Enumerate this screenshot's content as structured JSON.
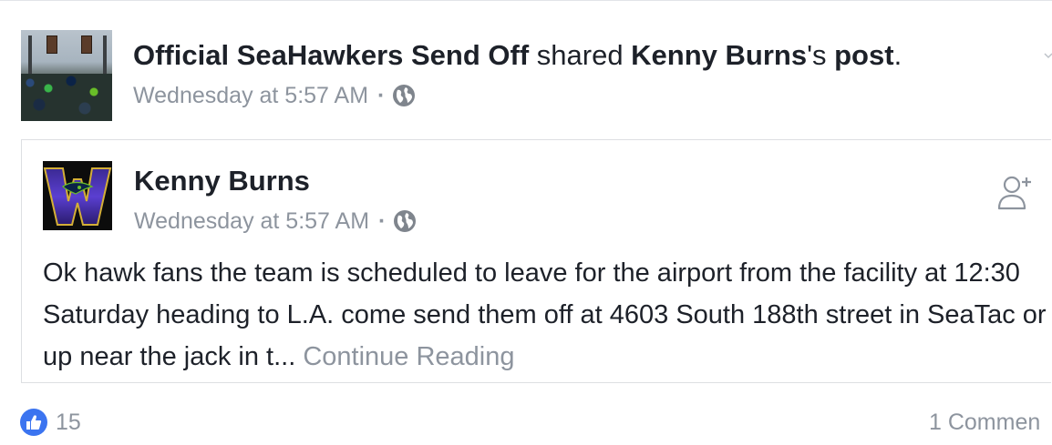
{
  "shared_post": {
    "page_name": "Official SeaHawkers Send Off",
    "action_text": " shared ",
    "original_author": "Kenny Burns",
    "possessive": "'s ",
    "object": "post",
    "period": ".",
    "timestamp": "Wednesday at 5:57 AM",
    "separator": "·",
    "audience_icon": "globe-icon"
  },
  "original_post": {
    "author": "Kenny Burns",
    "timestamp": "Wednesday at 5:57 AM",
    "separator": "·",
    "audience_icon": "globe-icon",
    "text": "Ok hawk fans the team is scheduled to leave for the airport from the facility at 12:30 Saturday heading to L.A. come send them off at 4603 South 188th street in SeaTac or up near the jack in t... ",
    "continue_label": "Continue Reading",
    "action_icon": "add-friend-icon"
  },
  "footer": {
    "like_icon": "thumbs-up-icon",
    "like_count": "15",
    "comment_count": "1 Commen"
  },
  "colors": {
    "text": "#1d2129",
    "meta": "#8d949e",
    "like_blue": "#3b74f0",
    "border": "#dddfe2"
  }
}
